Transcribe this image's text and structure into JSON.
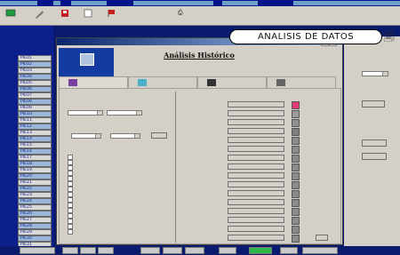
{
  "app": {
    "menu_items": [
      "",
      "",
      "",
      "",
      ""
    ],
    "toolbar_texts": [
      "",
      "",
      ""
    ],
    "tag_rows": [
      "PIE01",
      "PIE02",
      "PIE03",
      "PIE04",
      "PIE05",
      "PIE06",
      "PIE07",
      "PIE08",
      "PIE09",
      "PIE10",
      "PIE11",
      "PIE12",
      "PIE13",
      "PIE14",
      "PIE15",
      "PIE16",
      "PIE17",
      "PIE18",
      "PIE19",
      "PIE20",
      "PIE21",
      "PIE22",
      "PIE23",
      "PIE24",
      "PIE25",
      "PIE26",
      "PIE27",
      "PIE28",
      "PIE29",
      "PIE30",
      "PIE31"
    ],
    "right_panel": {
      "title": ""
    },
    "bottom_bar": []
  },
  "dialog": {
    "title": "",
    "heading": "Análisis Histórico",
    "tabs": [
      "",
      "",
      "",
      ""
    ],
    "active_tab": 0,
    "left_group": {
      "section_label": "",
      "from_label": "",
      "to_label": "",
      "from_date": "",
      "to_date": "",
      "hours_label": "",
      "start_label": "",
      "end_label": "",
      "accept_btn": "",
      "series_group_label": "",
      "series": [
        "",
        "",
        "",
        "",
        "",
        "",
        "",
        "",
        "",
        "",
        "",
        "",
        "",
        "",
        ""
      ]
    },
    "right_group": {
      "rows": [
        "",
        "",
        "",
        "",
        "",
        "",
        "",
        "",
        "",
        "",
        "",
        "",
        "",
        "",
        "",
        ""
      ],
      "swatch_colors": [
        "#e63a7a",
        "#9a9a9a",
        "#8f8f8f",
        "#7f7f7f",
        "#8a8a8a",
        "#8a8a8a",
        "#8a8a8a",
        "#8a8a8a",
        "#8a8a8a",
        "#8a8a8a",
        "#8a8a8a",
        "#8a8a8a",
        "#8a8a8a",
        "#8a8a8a",
        "#8a8a8a",
        "#8a8a8a"
      ]
    },
    "ok_btn": ""
  },
  "annotation": {
    "text": "ANALISIS DE DATOS"
  },
  "icons": [
    "green-monitor-icon",
    "wrench-icon",
    "disk-icon",
    "flag-icon",
    "doc-icon",
    "printer-icon"
  ]
}
